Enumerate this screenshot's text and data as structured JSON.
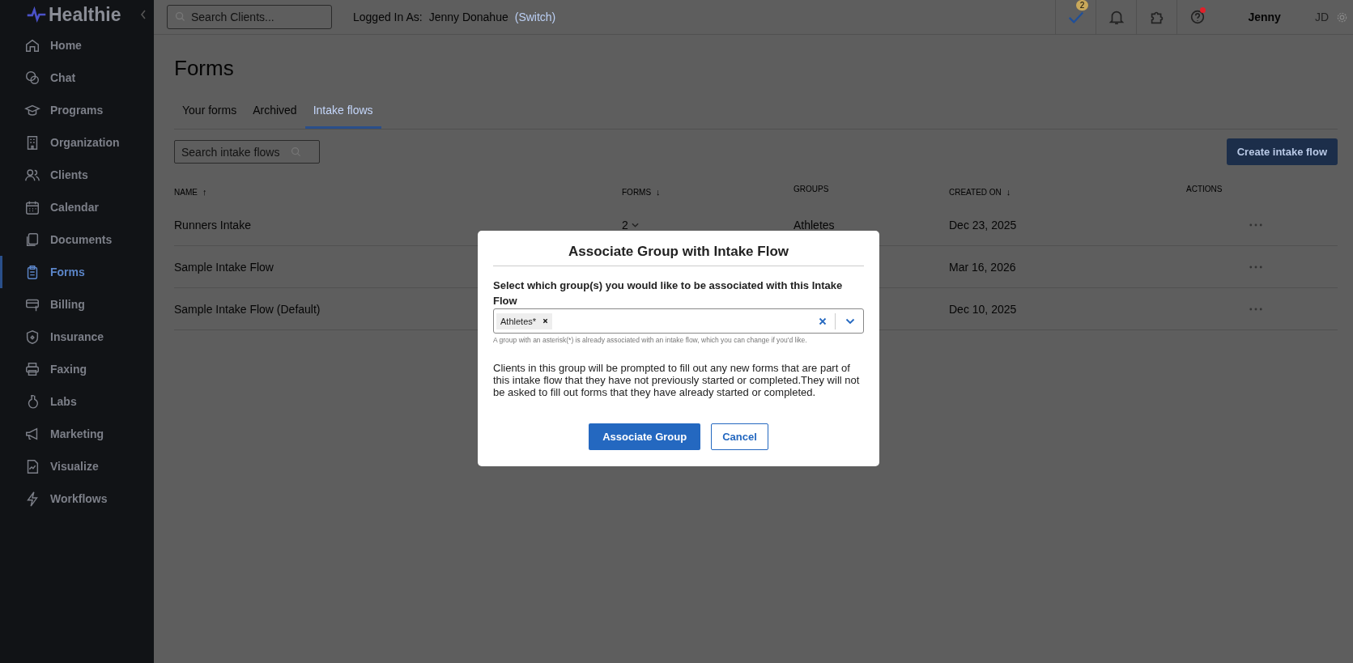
{
  "sidebar": {
    "logo": "Healthie",
    "items": [
      {
        "label": "Home",
        "selected": false
      },
      {
        "label": "Chat",
        "selected": false
      },
      {
        "label": "Programs",
        "selected": false
      },
      {
        "label": "Organization",
        "selected": false
      },
      {
        "label": "Clients",
        "selected": false
      },
      {
        "label": "Calendar",
        "selected": false
      },
      {
        "label": "Documents",
        "selected": false
      },
      {
        "label": "Forms",
        "selected": true
      },
      {
        "label": "Billing",
        "selected": false
      },
      {
        "label": "Insurance",
        "selected": false
      },
      {
        "label": "Faxing",
        "selected": false
      },
      {
        "label": "Labs",
        "selected": false
      },
      {
        "label": "Marketing",
        "selected": false
      },
      {
        "label": "Visualize",
        "selected": false
      },
      {
        "label": "Workflows",
        "selected": false
      }
    ]
  },
  "top_bar": {
    "search": {
      "placeholder": "Search Clients..."
    },
    "logged_in_label": "Logged In As:",
    "logged_in_user": "Jenny Donahue",
    "switch_link": "(Switch)",
    "tasks_badge": "2",
    "help_alert": true,
    "user_name": "Jenny",
    "initials": "JD"
  },
  "page": {
    "title": "Forms",
    "tabs": [
      {
        "label": "Your forms",
        "selected": false
      },
      {
        "label": "Archived",
        "selected": false
      },
      {
        "label": "Intake flows",
        "selected": true
      }
    ],
    "search": {
      "placeholder": "Search intake flows"
    },
    "create_button": "Create intake flow"
  },
  "table": {
    "columns": [
      {
        "label": "NAME",
        "sort_arrow": "↑"
      },
      {
        "label": "FORMS",
        "sort_arrow": "↓"
      },
      {
        "label": "GROUPS"
      },
      {
        "label": "CREATED ON",
        "sort_arrow": "↓"
      },
      {
        "label": "ACTIONS"
      }
    ],
    "rows": [
      {
        "name": "Runners Intake",
        "forms": "2",
        "groups": "Athletes",
        "created_on": "Dec 23, 2025"
      },
      {
        "name": "Sample Intake Flow",
        "created_on": "Mar 16, 2026"
      },
      {
        "name": "Sample Intake Flow (Default)",
        "created_on": "Dec 10, 2025"
      }
    ]
  },
  "modal": {
    "title": "Associate Group with Intake Flow",
    "field_label": "Select which group(s) you would like to be associated with this Intake Flow",
    "tags": [
      "Athletes*"
    ],
    "hint": "A group with an asterisk(*) is already associated with an intake flow, which you can change if you'd like.",
    "description": "Clients in this group will be prompted to fill out any new forms that are part of this intake flow that they have not previously started or completed.They will not be asked to fill out forms that they have already started or completed.",
    "primary_button": "Associate Group",
    "cancel_button": "Cancel"
  }
}
